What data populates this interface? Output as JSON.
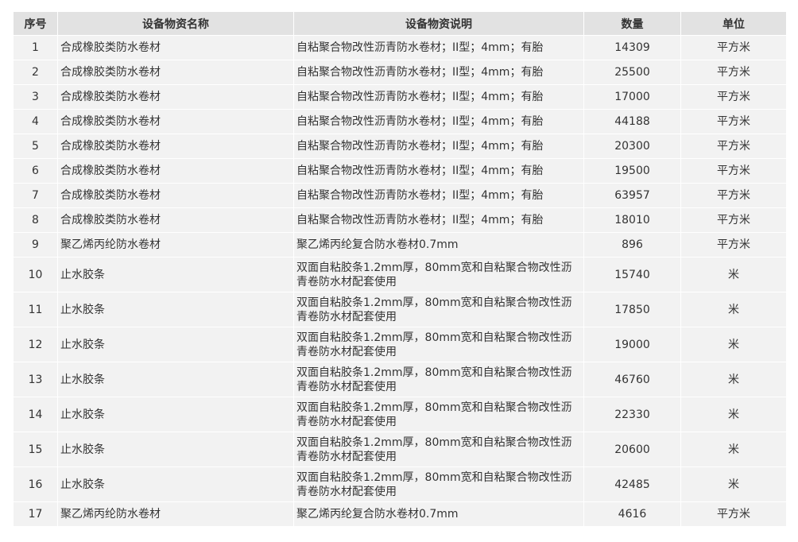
{
  "table": {
    "columns": [
      "序号",
      "设备物资名称",
      "设备物资说明",
      "数量",
      "单位"
    ],
    "rows": [
      {
        "no": "1",
        "name": "合成橡胶类防水卷材",
        "desc": "自粘聚合物改性沥青防水卷材；II型；4mm；有胎",
        "qty": "14309",
        "unit": "平方米"
      },
      {
        "no": "2",
        "name": "合成橡胶类防水卷材",
        "desc": "自粘聚合物改性沥青防水卷材；II型；4mm；有胎",
        "qty": "25500",
        "unit": "平方米"
      },
      {
        "no": "3",
        "name": "合成橡胶类防水卷材",
        "desc": "自粘聚合物改性沥青防水卷材；II型；4mm；有胎",
        "qty": "17000",
        "unit": "平方米"
      },
      {
        "no": "4",
        "name": "合成橡胶类防水卷材",
        "desc": "自粘聚合物改性沥青防水卷材；II型；4mm；有胎",
        "qty": "44188",
        "unit": "平方米"
      },
      {
        "no": "5",
        "name": "合成橡胶类防水卷材",
        "desc": "自粘聚合物改性沥青防水卷材；II型；4mm；有胎",
        "qty": "20300",
        "unit": "平方米"
      },
      {
        "no": "6",
        "name": "合成橡胶类防水卷材",
        "desc": "自粘聚合物改性沥青防水卷材；II型；4mm；有胎",
        "qty": "19500",
        "unit": "平方米"
      },
      {
        "no": "7",
        "name": "合成橡胶类防水卷材",
        "desc": "自粘聚合物改性沥青防水卷材；II型；4mm；有胎",
        "qty": "63957",
        "unit": "平方米"
      },
      {
        "no": "8",
        "name": "合成橡胶类防水卷材",
        "desc": "自粘聚合物改性沥青防水卷材；II型；4mm；有胎",
        "qty": "18010",
        "unit": "平方米"
      },
      {
        "no": "9",
        "name": "聚乙烯丙纶防水卷材",
        "desc": "聚乙烯丙纶复合防水卷材0.7mm",
        "qty": "896",
        "unit": "平方米"
      },
      {
        "no": "10",
        "name": "止水胶条",
        "desc": "双面自粘胶条1.2mm厚，80mm宽和自粘聚合物改性沥青卷防水材配套使用",
        "qty": "15740",
        "unit": "米"
      },
      {
        "no": "11",
        "name": "止水胶条",
        "desc": "双面自粘胶条1.2mm厚，80mm宽和自粘聚合物改性沥青卷防水材配套使用",
        "qty": "17850",
        "unit": "米"
      },
      {
        "no": "12",
        "name": "止水胶条",
        "desc": "双面自粘胶条1.2mm厚，80mm宽和自粘聚合物改性沥青卷防水材配套使用",
        "qty": "19000",
        "unit": "米"
      },
      {
        "no": "13",
        "name": "止水胶条",
        "desc": "双面自粘胶条1.2mm厚，80mm宽和自粘聚合物改性沥青卷防水材配套使用",
        "qty": "46760",
        "unit": "米"
      },
      {
        "no": "14",
        "name": "止水胶条",
        "desc": "双面自粘胶条1.2mm厚，80mm宽和自粘聚合物改性沥青卷防水材配套使用",
        "qty": "22330",
        "unit": "米"
      },
      {
        "no": "15",
        "name": "止水胶条",
        "desc": "双面自粘胶条1.2mm厚，80mm宽和自粘聚合物改性沥青卷防水材配套使用",
        "qty": "20600",
        "unit": "米"
      },
      {
        "no": "16",
        "name": "止水胶条",
        "desc": "双面自粘胶条1.2mm厚，80mm宽和自粘聚合物改性沥青卷防水材配套使用",
        "qty": "42485",
        "unit": "米"
      },
      {
        "no": "17",
        "name": "聚乙烯丙纶防水卷材",
        "desc": "聚乙烯丙纶复合防水卷材0.7mm",
        "qty": "4616",
        "unit": "平方米"
      }
    ]
  },
  "colors": {
    "header_bg": "#e2e2e2",
    "cell_bg": "#f2f2f2",
    "text": "#333333"
  }
}
